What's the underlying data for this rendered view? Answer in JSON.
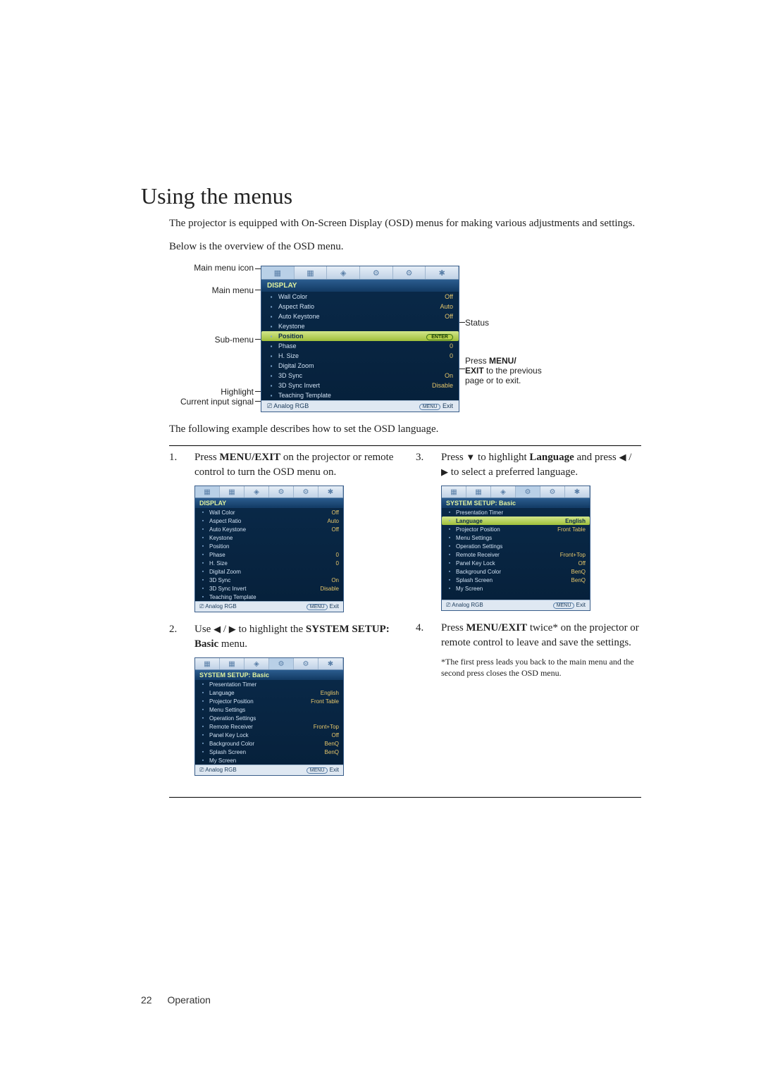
{
  "heading": "Using the menus",
  "intro1": "The projector is equipped with On-Screen Display (OSD) menus for making various adjustments and settings.",
  "intro2": "Below is the overview of the OSD menu.",
  "labels": {
    "main_menu_icon": "Main menu icon",
    "main_menu": "Main menu",
    "sub_menu": "Sub-menu",
    "highlight": "Highlight",
    "current_input": "Current input signal",
    "status": "Status",
    "press_menu_exit": "Press MENU/\nEXIT to the previous page or to exit."
  },
  "display_menu": {
    "title": "DISPLAY",
    "items": [
      {
        "label": "Wall Color",
        "value": "Off"
      },
      {
        "label": "Aspect Ratio",
        "value": "Auto"
      },
      {
        "label": "Auto Keystone",
        "value": "Off"
      },
      {
        "label": "Keystone",
        "value": ""
      },
      {
        "label": "Position",
        "value": "ENTER",
        "highlight": true
      },
      {
        "label": "Phase",
        "value": "0"
      },
      {
        "label": "H. Size",
        "value": "0"
      },
      {
        "label": "Digital Zoom",
        "value": ""
      },
      {
        "label": "3D Sync",
        "value": "On"
      },
      {
        "label": "3D Sync Invert",
        "value": "Disable"
      },
      {
        "label": "Teaching Template",
        "value": ""
      }
    ],
    "footer_left": "Analog RGB",
    "footer_right_menu": "MENU",
    "footer_right_exit": "Exit"
  },
  "following_text": "The following example describes how to set the OSD language.",
  "step1_a": "Press ",
  "step1_b": "MENU/EXIT",
  "step1_c": " on the projector or remote control to turn the OSD menu on.",
  "step2_a": "Use ",
  "step2_b": " to highlight the ",
  "step2_c": "SYSTEM SETUP: Basic",
  "step2_d": " menu.",
  "step3_a": "Press ",
  "step3_b": " to highlight ",
  "step3_c": "Language",
  "step3_d": " and press ",
  "step3_e": " to select a preferred language.",
  "step4_a": "Press ",
  "step4_b": "MENU/EXIT",
  "step4_c": " twice* on the projector or remote control to leave and save the settings.",
  "note_text": "*The first press leads you back to the main menu and the second press closes the OSD menu.",
  "system_menu": {
    "title": "SYSTEM SETUP: Basic",
    "items": [
      {
        "label": "Presentation Timer",
        "value": ""
      },
      {
        "label": "Language",
        "value": "English"
      },
      {
        "label": "Projector Position",
        "value": "Front Table"
      },
      {
        "label": "Menu Settings",
        "value": ""
      },
      {
        "label": "Operation Settings",
        "value": ""
      },
      {
        "label": "Remote Receiver",
        "value": "Front+Top"
      },
      {
        "label": "Panel Key Lock",
        "value": "Off"
      },
      {
        "label": "Background Color",
        "value": "BenQ"
      },
      {
        "label": "Splash Screen",
        "value": "BenQ"
      },
      {
        "label": "My Screen",
        "value": ""
      }
    ],
    "footer_left": "Analog RGB",
    "footer_right_menu": "MENU",
    "footer_right_exit": "Exit"
  },
  "system_menu_hl": {
    "title": "SYSTEM SETUP: Basic",
    "items": [
      {
        "label": "Presentation Timer",
        "value": ""
      },
      {
        "label": "Language",
        "value": "English",
        "highlight": true
      },
      {
        "label": "Projector Position",
        "value": "Front Table"
      },
      {
        "label": "Menu Settings",
        "value": ""
      },
      {
        "label": "Operation Settings",
        "value": ""
      },
      {
        "label": "Remote Receiver",
        "value": "Front+Top"
      },
      {
        "label": "Panel Key Lock",
        "value": "Off"
      },
      {
        "label": "Background Color",
        "value": "BenQ"
      },
      {
        "label": "Splash Screen",
        "value": "BenQ"
      },
      {
        "label": "My Screen",
        "value": ""
      }
    ],
    "footer_left": "Analog RGB",
    "footer_right_menu": "MENU",
    "footer_right_exit": "Exit"
  },
  "footer": {
    "page_num": "22",
    "section": "Operation"
  },
  "tab_glyphs": [
    "▦",
    "▦",
    "◈",
    "⚙",
    "⚙",
    "✱"
  ]
}
